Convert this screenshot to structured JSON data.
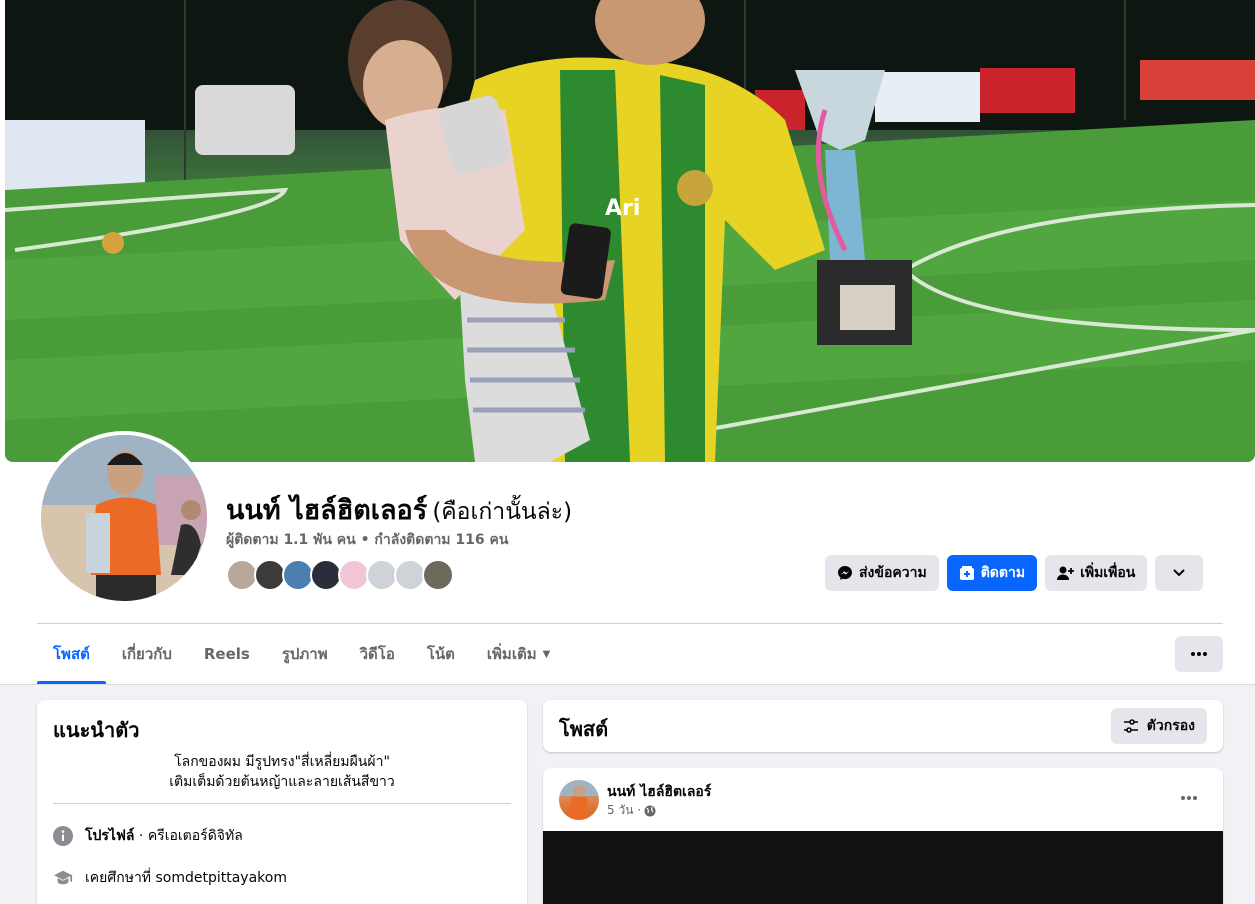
{
  "profile": {
    "name": "นนท์ ไฮล์ฮิตเลอร์",
    "alternate_name": "(คือเก่านั้นล่ะ)",
    "stats": "ผู้ติดตาม 1.1 พัน คน • กำลังติดตาม 116 คน"
  },
  "friends": [
    {
      "color": "#b9a89a"
    },
    {
      "color": "#3c3a3a"
    },
    {
      "color": "#4a7fb0"
    },
    {
      "color": "#2b2d3a"
    },
    {
      "color": "#f2c6d6"
    },
    {
      "color": "#cfd2d8"
    },
    {
      "color": "#cfd2d8"
    },
    {
      "color": "#6d6a5c"
    }
  ],
  "actions": {
    "message_label": "ส่งข้อความ",
    "follow_label": "ติดตาม",
    "add_friend_label": "เพิ่มเพื่อน"
  },
  "tabs": [
    {
      "label": "โพสต์",
      "active": true
    },
    {
      "label": "เกี่ยวกับ"
    },
    {
      "label": "Reels"
    },
    {
      "label": "รูปภาพ"
    },
    {
      "label": "วิดีโอ"
    },
    {
      "label": "โน้ต"
    },
    {
      "label": "เพิ่มเติม"
    }
  ],
  "intro": {
    "title": "แนะนำตัว",
    "bio_line1": "โลกของผม มีรูปทรง\"สี่เหลี่ยมผืนผ้า\"",
    "bio_line2": "เติมเต็มด้วยต้นหญ้าและลายเส้นสีขาว",
    "profile_label": "โปรไฟล์",
    "profile_value": " · ครีเอเตอร์ดิจิทัล",
    "education": "เคยศึกษาที่ somdetpittayakom"
  },
  "posts": {
    "title": "โพสต์",
    "filter_label": "ตัวกรอง"
  },
  "post": {
    "author": "นนท์ ไฮล์ฮิตเลอร์",
    "time": "5 วัน ·"
  },
  "colors": {
    "accent": "#0866ff",
    "secondary_text": "#65676b",
    "button_gray": "#e4e6eb",
    "page_bg": "#f0f2f5"
  }
}
